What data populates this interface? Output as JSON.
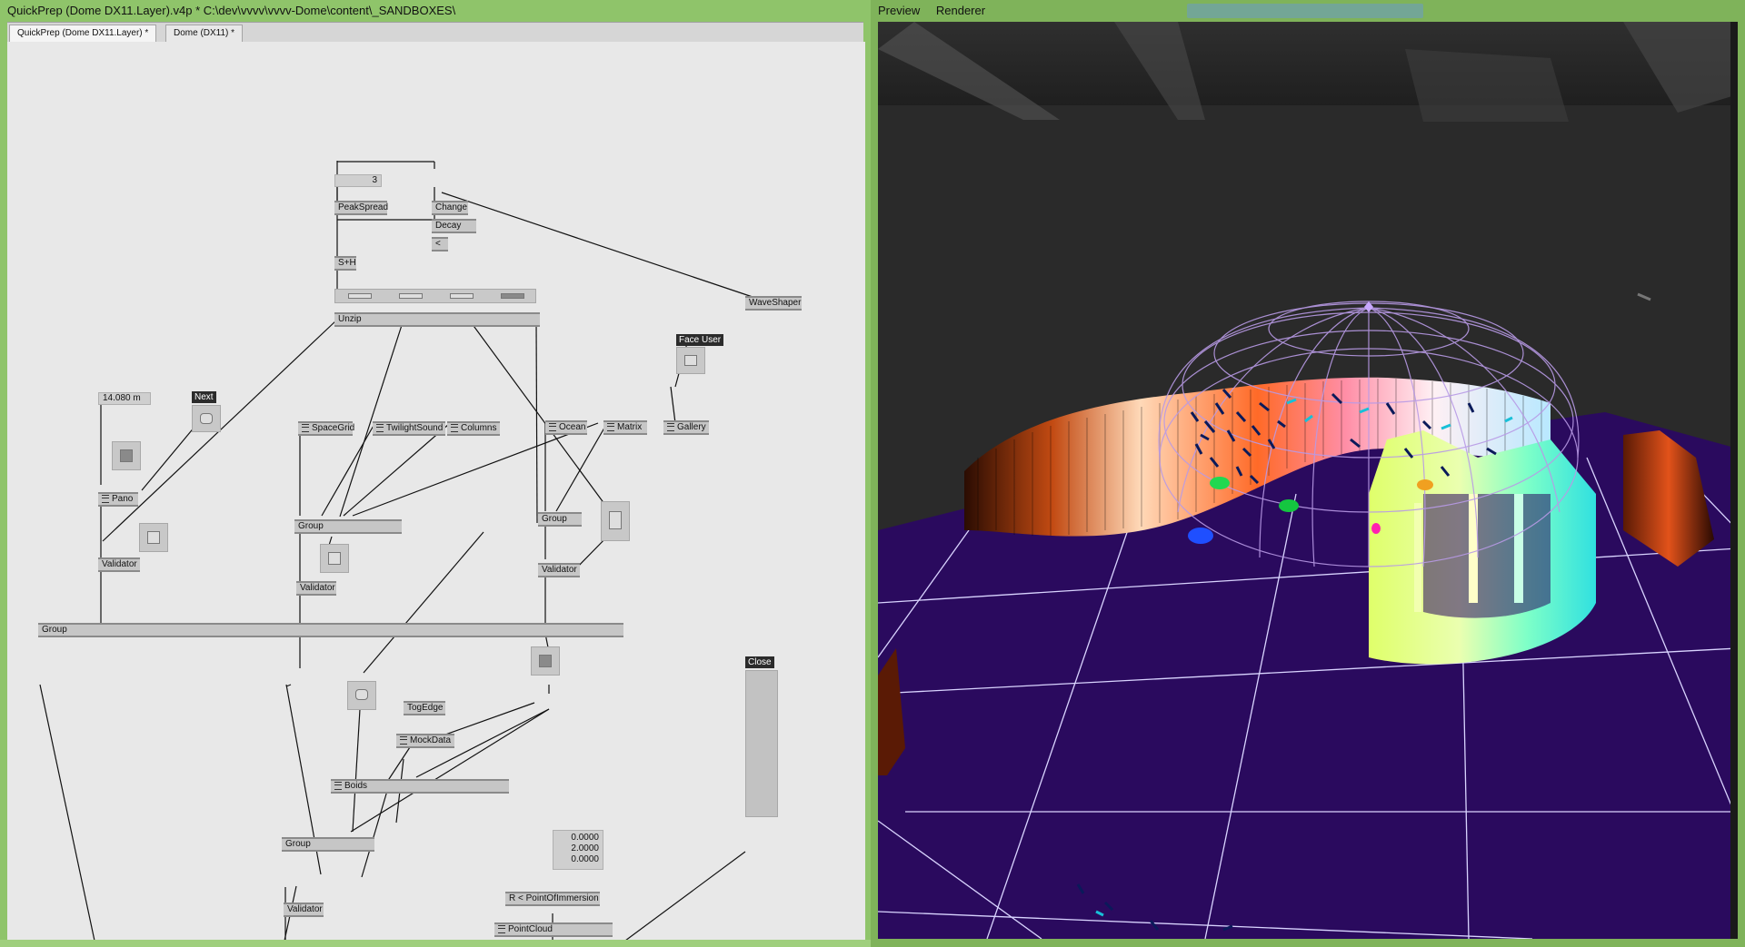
{
  "left_window": {
    "title": "QuickPrep (Dome DX11.Layer).v4p *  C:\\dev\\vvvv\\vvvv-Dome\\content\\_SANDBOXES\\",
    "tabs": [
      {
        "label": "QuickPrep (Dome DX11.Layer) *"
      },
      {
        "label": "Dome (DX11) *"
      }
    ],
    "nodes": {
      "iobox_3": "3",
      "peakspread": "PeakSpread",
      "change": "Change",
      "decay": "Decay",
      "lt": "<",
      "sh": "S+H",
      "waveshaper": "WaveShaper",
      "unzip": "Unzip",
      "distance": "14.080 m",
      "next": "Next",
      "face_user": "Face User",
      "pano": "Pano",
      "spacegrid": "SpaceGrid",
      "twilightsound": "TwilightSound",
      "columns": "Columns",
      "ocean": "Ocean",
      "matrix": "Matrix",
      "gallery": "Gallery",
      "group_a": "Group",
      "group_b": "Group",
      "validator_a": "Validator",
      "validator_b": "Validator",
      "validator_c": "Validator",
      "group_main": "Group",
      "close": "Close",
      "togedge": "TogEdge",
      "mockdata": "MockData",
      "boids": "Boids",
      "group_c": "Group",
      "validator_d": "Validator",
      "vec_values": [
        "0.0000",
        "2.0000",
        "0.0000"
      ],
      "pointofimmersion": "R < PointOfImmersion",
      "pointcloud": "PointCloud"
    }
  },
  "right_window": {
    "menu": [
      "Preview",
      "Renderer"
    ]
  },
  "colors": {
    "frame_green": "#8fc46a",
    "patch_bg": "#e8e8e8",
    "floor": "#2a0a5e",
    "grid_line": "#d9d4ff",
    "dome_wire": "#b89ae6"
  },
  "icons": {
    "module": "module-icon",
    "bang": "bang-button-icon",
    "toggle": "toggle-button-icon"
  }
}
